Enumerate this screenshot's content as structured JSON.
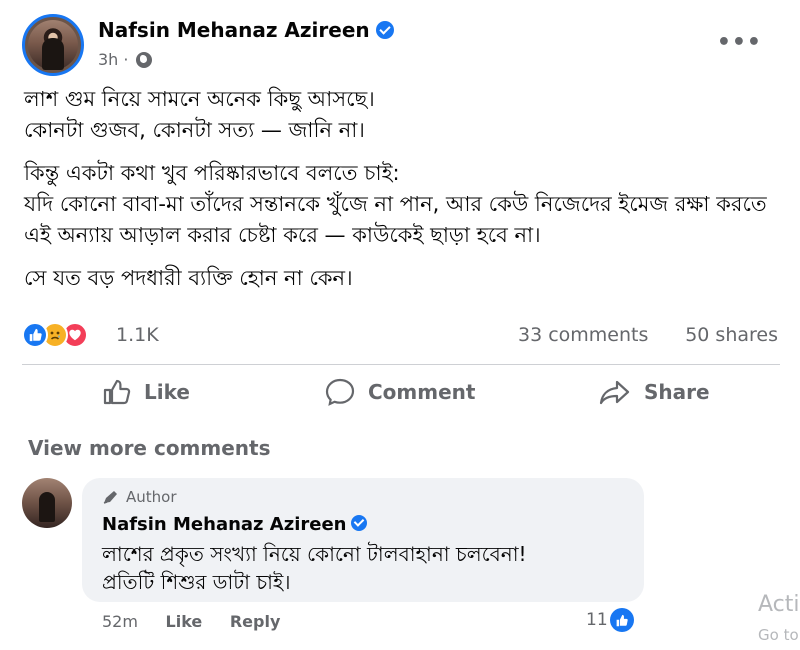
{
  "post": {
    "author": "Nafsin Mehanaz Azireen",
    "time": "3h",
    "more": "•••",
    "paragraphs": [
      "লাশ গুম নিয়ে সামনে অনেক কিছু আসছে।\nকোনটা গুজব, কোনটা সত্য — জানি না।",
      "কিন্তু একটা কথা খুব পরিষ্কারভাবে বলতে চাই:\nযদি কোনো বাবা-মা তাঁদের সন্তানকে খুঁজে না পান, আর কেউ নিজেদের ইমেজ রক্ষা করতে এই অন্যায় আড়াল করার চেষ্টা করে — কাউকেই ছাড়া হবে না।",
      "সে যত বড় পদধারী ব্যক্তি হোন না কেন।"
    ]
  },
  "reactions": {
    "count": "1.1K",
    "comments": "33 comments",
    "shares": "50 shares",
    "icons": [
      "like-icon",
      "sad-icon",
      "love-icon"
    ]
  },
  "actions": {
    "like": "Like",
    "comment": "Comment",
    "share": "Share"
  },
  "comments_section": {
    "view_more": "View more comments",
    "comment": {
      "badge": "Author",
      "author": "Nafsin Mehanaz Azireen",
      "text": "লাশের প্রকৃত সংখ্যা নিয়ে কোনো টালবাহানা চলবেনা!\nপ্রতিটি শিশুর ডাটা চাই।",
      "time": "52m",
      "like": "Like",
      "reply": "Reply",
      "likes": "11"
    }
  },
  "watermark": {
    "line1": "Acti",
    "line2": "Go to"
  },
  "colors": {
    "accent": "#1877f2",
    "secondary_text": "#65676b",
    "bubble": "#f0f2f5",
    "love": "#f33e58",
    "sad": "#f7b125"
  }
}
